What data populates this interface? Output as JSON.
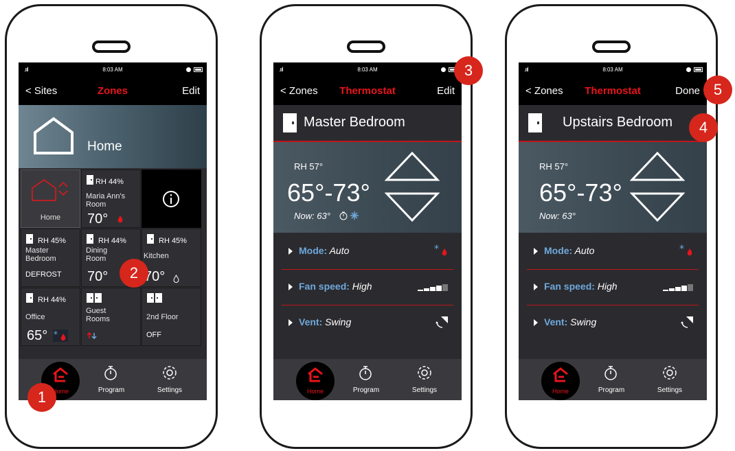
{
  "phone1": {
    "status": {
      "signal": ".ııl ",
      "time": "8:03 AM"
    },
    "nav": {
      "back": "< Sites",
      "title": "Zones",
      "action": "Edit"
    },
    "hero_label": "Home",
    "tiles": [
      {
        "name": "Home"
      },
      {
        "rh": "RH 44%",
        "name": "Maria Ann's Room",
        "temp": "70°"
      },
      {
        "rh": "RH 45%",
        "name": "Master Bedroom",
        "state": "DEFROST"
      },
      {
        "rh": "RH 44%",
        "name": "Dining Room",
        "temp": "70°"
      },
      {
        "rh": "RH 45%",
        "name": "Kitchen",
        "temp": "70°"
      },
      {
        "rh": "RH 44%",
        "name": "Office",
        "temp": "65°"
      },
      {
        "name": "Guest Rooms"
      },
      {
        "name": "2nd Floor",
        "state": "OFF"
      }
    ],
    "tabs": {
      "home": "Home",
      "program": "Program",
      "settings": "Settings"
    }
  },
  "phone2": {
    "status": {
      "signal": ".ııl ",
      "time": "8:03 AM"
    },
    "nav": {
      "back": "< Zones",
      "title": "Thermostat",
      "action": "Edit"
    },
    "zone": "Master Bedroom",
    "rh": "RH 57°",
    "range": "65°-73°",
    "now": "Now: 63°",
    "rows": {
      "mode_key": "Mode:",
      "mode_val": " Auto",
      "fan_key": "Fan speed:",
      "fan_val": " High",
      "vent_key": "Vent:",
      "vent_val": " Swing"
    },
    "tabs": {
      "home": "Home",
      "program": "Program",
      "settings": "Settings"
    }
  },
  "phone3": {
    "status": {
      "signal": ".ııl ",
      "time": "8:03 AM"
    },
    "nav": {
      "back": "< Zones",
      "title": "Thermostat",
      "action": "Done"
    },
    "zone": "Upstairs Bedroom",
    "rh": "RH 57°",
    "range": "65°-73°",
    "now": "Now: 63°",
    "rows": {
      "mode_key": "Mode:",
      "mode_val": " Auto",
      "fan_key": "Fan speed:",
      "fan_val": " High",
      "vent_key": "Vent:",
      "vent_val": " Swing"
    },
    "tabs": {
      "home": "Home",
      "program": "Program",
      "settings": "Settings"
    }
  },
  "badges": [
    "1",
    "2",
    "3",
    "4",
    "5"
  ],
  "colors": {
    "accent_red": "#e8141b",
    "badge_red": "#d7261c",
    "link_blue": "#6fa8dc",
    "screen_bg": "#2b2b2f"
  }
}
